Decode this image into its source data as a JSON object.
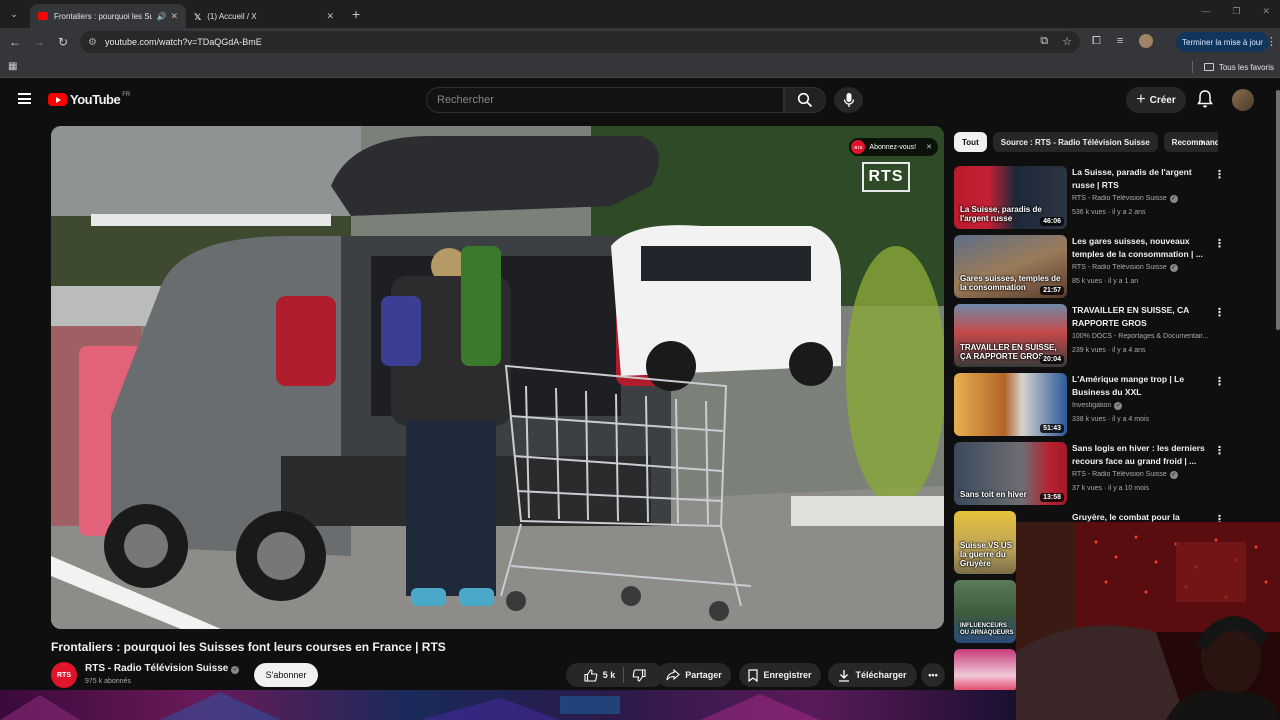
{
  "browser": {
    "tabs": [
      {
        "title": "Frontaliers : pourquoi les Su",
        "active": true,
        "favicon": "youtube-favicon"
      },
      {
        "title": "(1) Accueil / X",
        "active": false,
        "favicon": "x-favicon"
      }
    ],
    "url": "youtube.com/watch?v=TDaQGdA-BmE",
    "update_button": "Terminer la mise à jour",
    "bookmarks_label": "Tous les favoris"
  },
  "youtube": {
    "logo_text": "YouTube",
    "country_code": "FR",
    "search_placeholder": "Rechercher",
    "create_label": "Créer"
  },
  "player": {
    "watermark": "RTS",
    "subscribe_overlay": "Abonnez-vous!",
    "channel_badge": "RTS"
  },
  "video": {
    "title": "Frontaliers : pourquoi les Suisses font leurs courses en France | RTS",
    "channel_name": "RTS - Radio Télévision Suisse",
    "channel_avatar_text": "RTS",
    "subscribers": "975 k abonnés",
    "subscribe_label": "S'abonner",
    "likes": "5 k",
    "share_label": "Partager",
    "save_label": "Enregistrer",
    "download_label": "Télécharger"
  },
  "chips": [
    "Tout",
    "Source : RTS - Radio Télévision Suisse",
    "Recommandations"
  ],
  "recommendations": [
    {
      "title": "La Suisse, paradis de l'argent russe | RTS",
      "channel": "RTS - Radio Télévision Suisse",
      "verified": true,
      "meta": "536 k vues · il y a 2 ans",
      "duration": "46:06",
      "thumb_caption": "La Suisse, paradis de l'argent russe"
    },
    {
      "title": "Les gares suisses, nouveaux temples de la consommation | ...",
      "channel": "RTS - Radio Télévision Suisse",
      "verified": true,
      "meta": "85 k vues · il y a 1 an",
      "duration": "21:57",
      "thumb_caption": "Gares suisses, temples de la consommation"
    },
    {
      "title": "TRAVAILLER EN SUISSE, CA RAPPORTE GROS",
      "channel": "100% DOCS - Reportages & Documentair...",
      "verified": false,
      "meta": "239 k vues · il y a 4 ans",
      "duration": "20:04",
      "thumb_caption": "TRAVAILLER EN SUISSE, ÇA RAPPORTE GROS"
    },
    {
      "title": "L'Amérique mange trop | Le Business du XXL",
      "channel": "Investigation",
      "verified": true,
      "meta": "338 k vues · il y a 4 mois",
      "duration": "51:43",
      "thumb_caption": ""
    },
    {
      "title": "Sans logis en hiver : les derniers recours face au grand froid | ...",
      "channel": "RTS - Radio Télévision Suisse",
      "verified": true,
      "meta": "37 k vues · il y a 10 mois",
      "duration": "13:58",
      "thumb_caption": "Sans toit en hiver"
    },
    {
      "title": "Gruyère, le combat pour la",
      "channel": "",
      "verified": false,
      "meta": "",
      "duration": "",
      "thumb_caption": "Suisse VS US la guerre du Gruyère"
    },
    {
      "title": "",
      "channel": "",
      "verified": false,
      "meta": "",
      "duration": "",
      "thumb_caption": "INFLUENCEURS OU ARNAQUEURS"
    },
    {
      "title": "",
      "channel": "",
      "verified": false,
      "meta": "",
      "duration": "",
      "thumb_caption": ""
    }
  ]
}
